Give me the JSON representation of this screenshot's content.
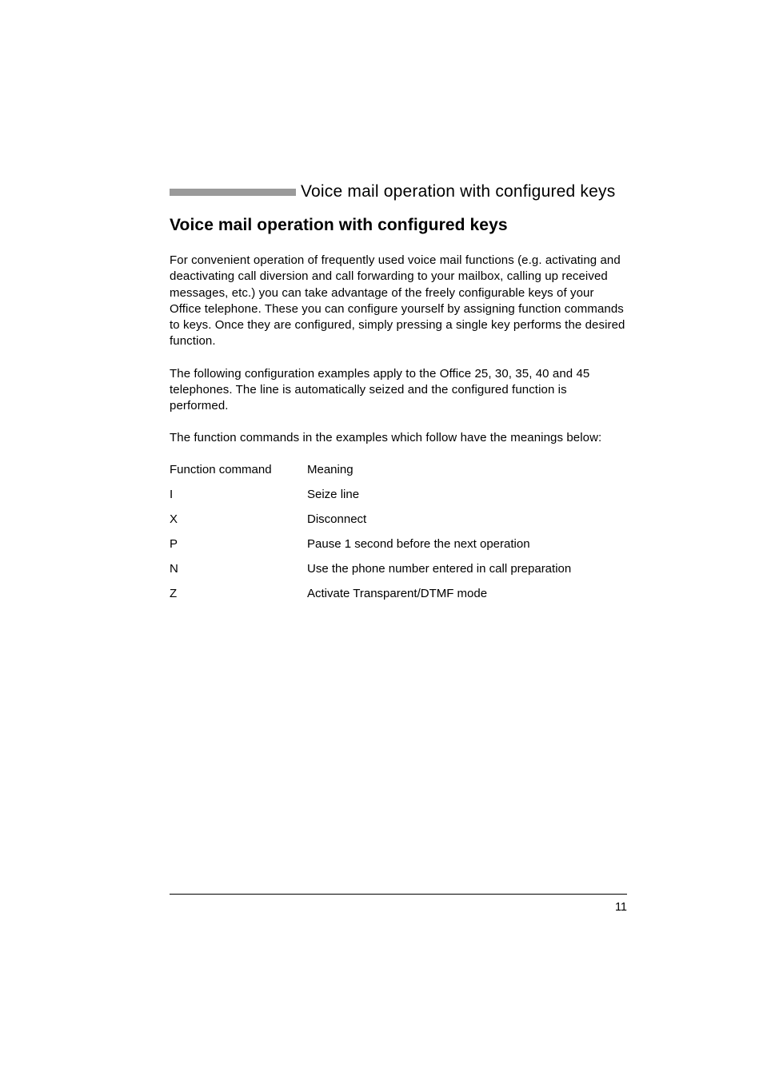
{
  "header": {
    "running_title": "Voice mail operation with configured keys"
  },
  "heading": "Voice mail operation with configured keys",
  "paragraphs": {
    "p1": "For convenient operation of frequently used voice mail functions (e.g. activating and deactivating call diversion and call forwarding to your mailbox, calling up received messages, etc.) you can take advantage of the freely configurable keys of your Office telephone. These you can configure yourself by assigning function commands to keys. Once they are configured, simply pressing a single key performs the desired function.",
    "p2": "The following configuration examples apply to the Office 25, 30, 35, 40 and 45 telephones. The line is automatically seized and the configured function is performed.",
    "p3": "The function commands in the examples which follow have the meanings below:"
  },
  "table": {
    "header": {
      "col1": "Function command",
      "col2": "Meaning"
    },
    "rows": [
      {
        "cmd": "I",
        "meaning": "Seize line"
      },
      {
        "cmd": "X",
        "meaning": "Disconnect"
      },
      {
        "cmd": "P",
        "meaning": "Pause 1 second before the next operation"
      },
      {
        "cmd": "N",
        "meaning": "Use the phone number entered in call preparation"
      },
      {
        "cmd": "Z",
        "meaning": "Activate Transparent/DTMF mode"
      }
    ]
  },
  "page_number": "11"
}
